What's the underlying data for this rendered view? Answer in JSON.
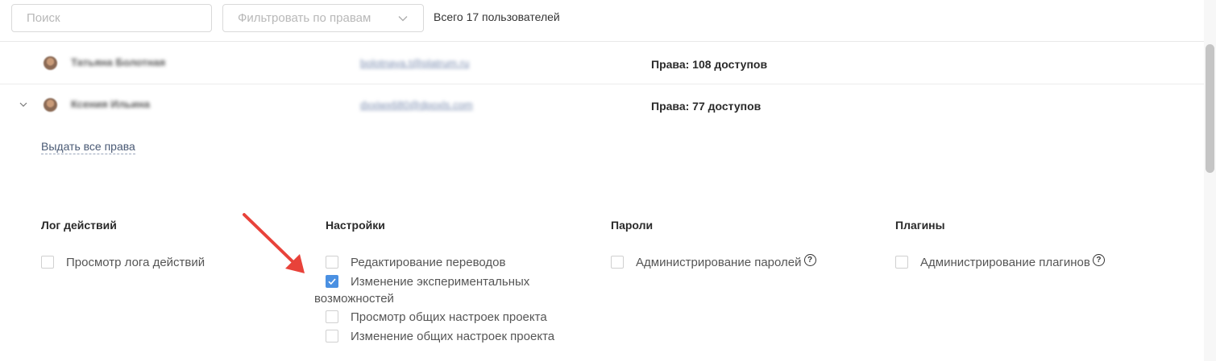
{
  "toolbar": {
    "search_placeholder": "Поиск",
    "filter_placeholder": "Фильтровать по правам",
    "total": "Всего 17 пользователей"
  },
  "users": [
    {
      "name": "Татьяна Болотная",
      "email": "bolotnaya.t@platrum.ru",
      "rights": "Права: 108 доступов"
    },
    {
      "name": "Ксения Ильина",
      "email": "dxxiwx680@dpoxls.com",
      "rights": "Права: 77 доступов"
    }
  ],
  "grant_all": "Выдать все права",
  "groups": [
    {
      "title": "Лог действий",
      "items": [
        {
          "label": "Просмотр лога действий",
          "checked": false
        }
      ]
    },
    {
      "title": "Настройки",
      "items": [
        {
          "label": "Редактирование переводов",
          "checked": false
        },
        {
          "label_line1": "Изменение экспериментальных",
          "label_line2": "возможностей",
          "checked": true
        },
        {
          "label": "Просмотр общих настроек проекта",
          "checked": false
        },
        {
          "label": "Изменение общих настроек проекта",
          "checked": false
        }
      ]
    },
    {
      "title": "Пароли",
      "items": [
        {
          "label": "Администрирование паролей",
          "checked": false
        }
      ]
    },
    {
      "title": "Плагины",
      "items": [
        {
          "label": "Администрирование плагинов",
          "checked": false
        }
      ]
    }
  ],
  "colors": {
    "accent": "#4a90e2",
    "annotation_arrow": "#e8423a",
    "link": "#4a5a75"
  },
  "icons": {
    "help": "?"
  }
}
